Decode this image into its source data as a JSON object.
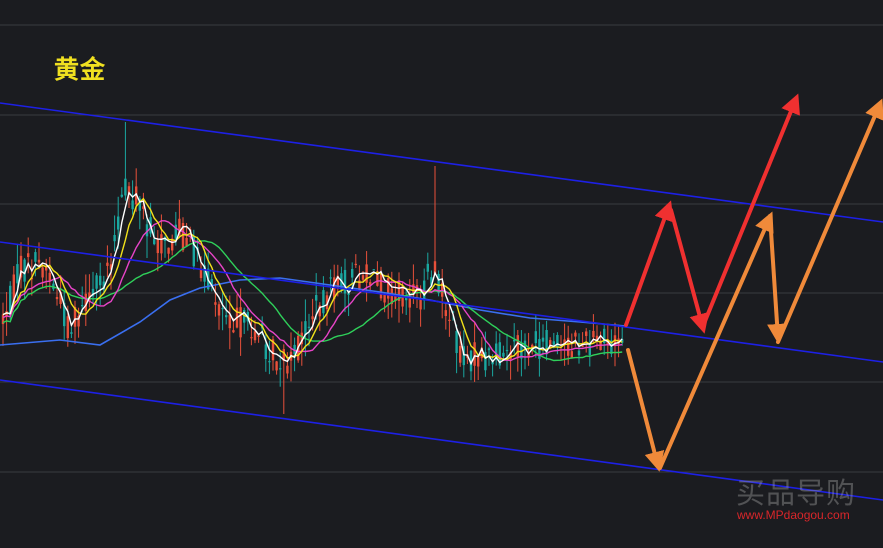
{
  "title": "黄金",
  "watermark": {
    "name": "买品导购",
    "url": "www.MPdaogou.com"
  },
  "colors": {
    "background": "#1b1c20",
    "grid": "#3a3b40",
    "channel": "#1d20e6",
    "candle_up": "#e8503a",
    "candle_down": "#1aa7a0",
    "ma5": "#ffffff",
    "ma10": "#f2e21a",
    "ma20": "#e844c8",
    "ma30": "#2fd05a",
    "ma60": "#3a6ff0",
    "arrow_red": "#f03030",
    "arrow_orange": "#f08a3a",
    "title": "#f0e020"
  },
  "chart_data": {
    "type": "candlestick",
    "title": "黄金",
    "grid": true,
    "xlabel": "",
    "ylabel": "",
    "series": [
      {
        "type": "candlestick",
        "color_up": "#e8503a",
        "color_down": "#1aa7a0"
      },
      {
        "type": "line",
        "color": "#ffffff"
      },
      {
        "type": "line",
        "color": "#f2e21a"
      },
      {
        "type": "line",
        "color": "#e844c8"
      },
      {
        "type": "line",
        "color": "#2fd05a"
      },
      {
        "type": "line",
        "color": "#3a6ff0"
      }
    ],
    "annotations": [
      {
        "type": "trend-channel",
        "color": "#1d20e6"
      },
      {
        "type": "scenario-path",
        "color": "#f03030"
      },
      {
        "type": "scenario-path",
        "color": "#f08a3a"
      }
    ]
  }
}
